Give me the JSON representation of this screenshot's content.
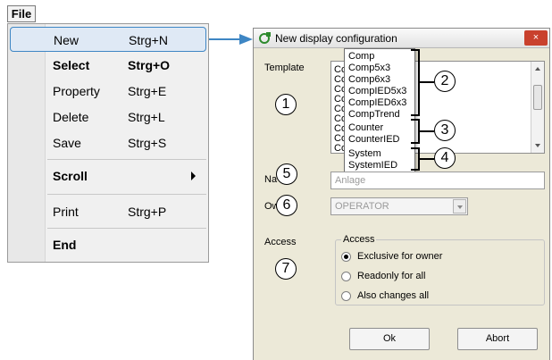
{
  "menu": {
    "tab_label": "File",
    "items": [
      {
        "label": "New",
        "shortcut": "Strg+N"
      },
      {
        "label": "Select",
        "shortcut": "Strg+O"
      },
      {
        "label": "Property",
        "shortcut": "Strg+E"
      },
      {
        "label": "Delete",
        "shortcut": "Strg+L"
      },
      {
        "label": "Save",
        "shortcut": "Strg+S"
      },
      {
        "label": "Scroll",
        "shortcut": ""
      },
      {
        "label": "Print",
        "shortcut": "Strg+P"
      },
      {
        "label": "End",
        "shortcut": ""
      }
    ]
  },
  "dialog": {
    "title": "New display configuration",
    "close_glyph": "×",
    "template_label": "Template",
    "template_list_prefix": [
      "Co",
      "Co",
      "Co",
      "Co",
      "Co",
      "Co",
      "Co",
      "Co",
      "Co"
    ],
    "dropdown_items": [
      "Comp",
      "Comp5x3",
      "Comp6x3",
      "CompIED5x3",
      "CompIED6x3",
      "CompTrend",
      "Counter",
      "CounterIED",
      "System",
      "SystemIED"
    ],
    "name_label": "Na",
    "name_value": "Anlage",
    "owner_label": "Ow",
    "owner_value": "OPERATOR",
    "access_label": "Access",
    "access_group_title": "Access",
    "access_options": [
      "Exclusive for owner",
      "Readonly for all",
      "Also changes all"
    ],
    "access_selected": "Exclusive for owner",
    "ok_label": "Ok",
    "abort_label": "Abort"
  },
  "callouts": [
    "1",
    "2",
    "3",
    "4",
    "5",
    "6",
    "7"
  ],
  "colors": {
    "menu_highlight_border": "#3e86c4",
    "arrow": "#3e86c4",
    "dialog_bg": "#ece9d8",
    "close_button": "#c9412d",
    "title_icon": "#2d8a2d"
  }
}
